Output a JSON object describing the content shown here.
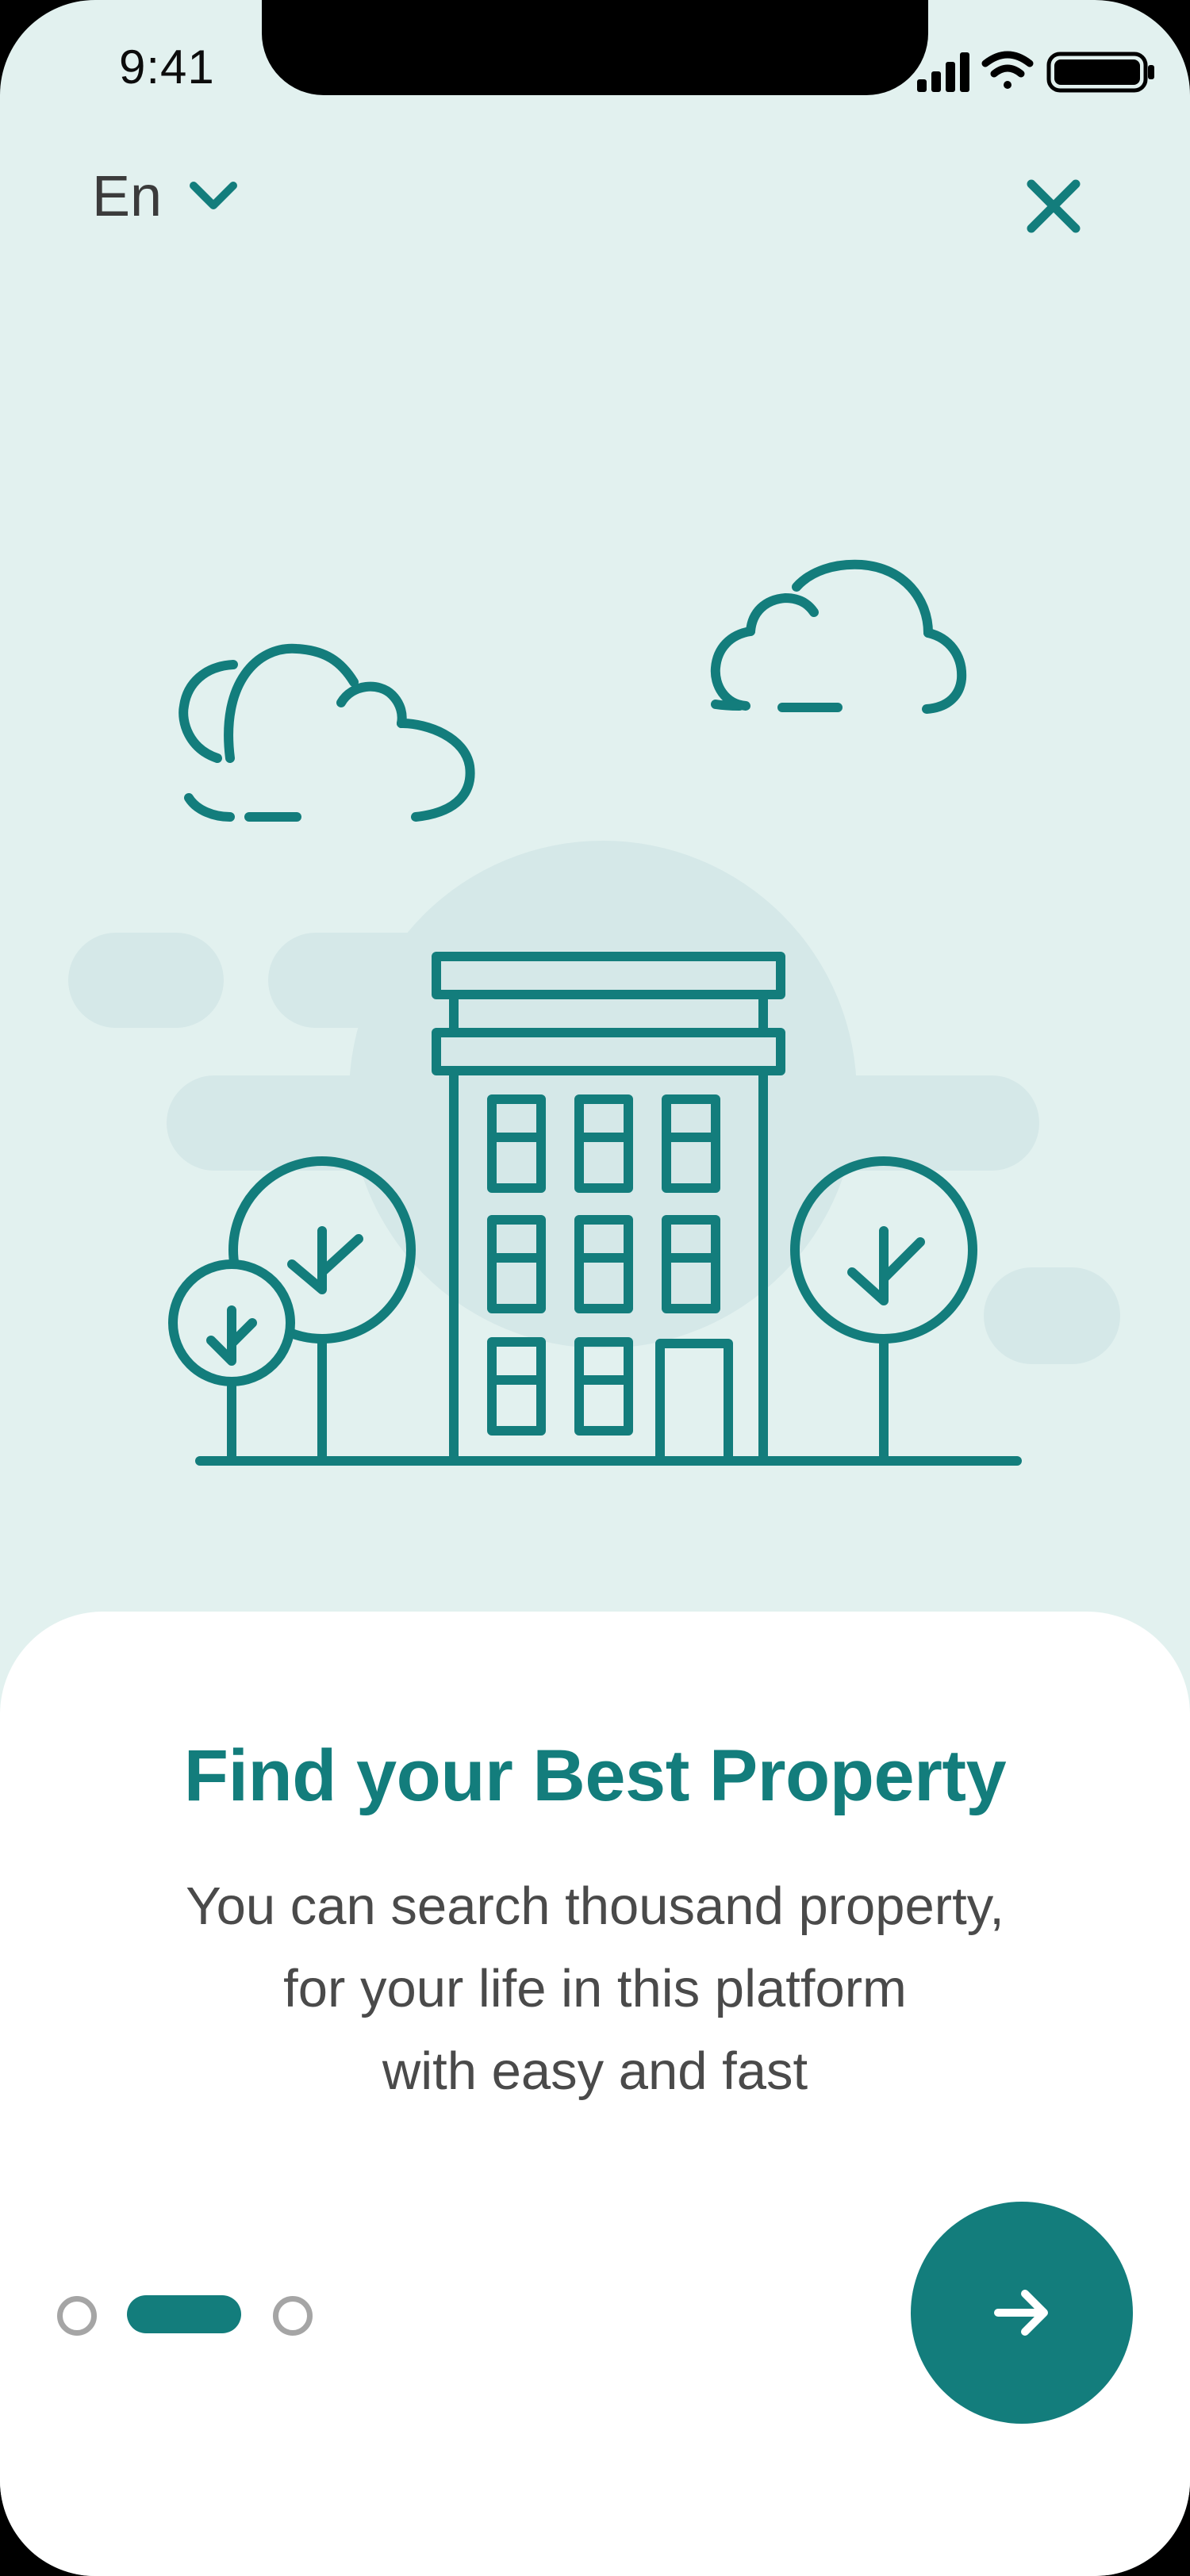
{
  "status_bar": {
    "time": "9:41"
  },
  "header": {
    "language": "En",
    "language_icon": "chevron-down-icon",
    "close_icon": "close-icon"
  },
  "illustration": {
    "subject": "apartment-building-with-trees-and-clouds",
    "stroke_color": "#137D7C",
    "blob_color": "#D5E8E8"
  },
  "onboarding": {
    "title": "Find your Best Property",
    "description_lines": [
      "You can search thousand property,",
      "for your life in this platform",
      "with easy and fast"
    ],
    "page_count": 3,
    "current_page": 2,
    "next_icon": "arrow-right-icon"
  },
  "colors": {
    "accent": "#137D7C",
    "background": "#E2F1EF",
    "card": "#FFFFFF",
    "dot_inactive": "#A5A5A5"
  }
}
